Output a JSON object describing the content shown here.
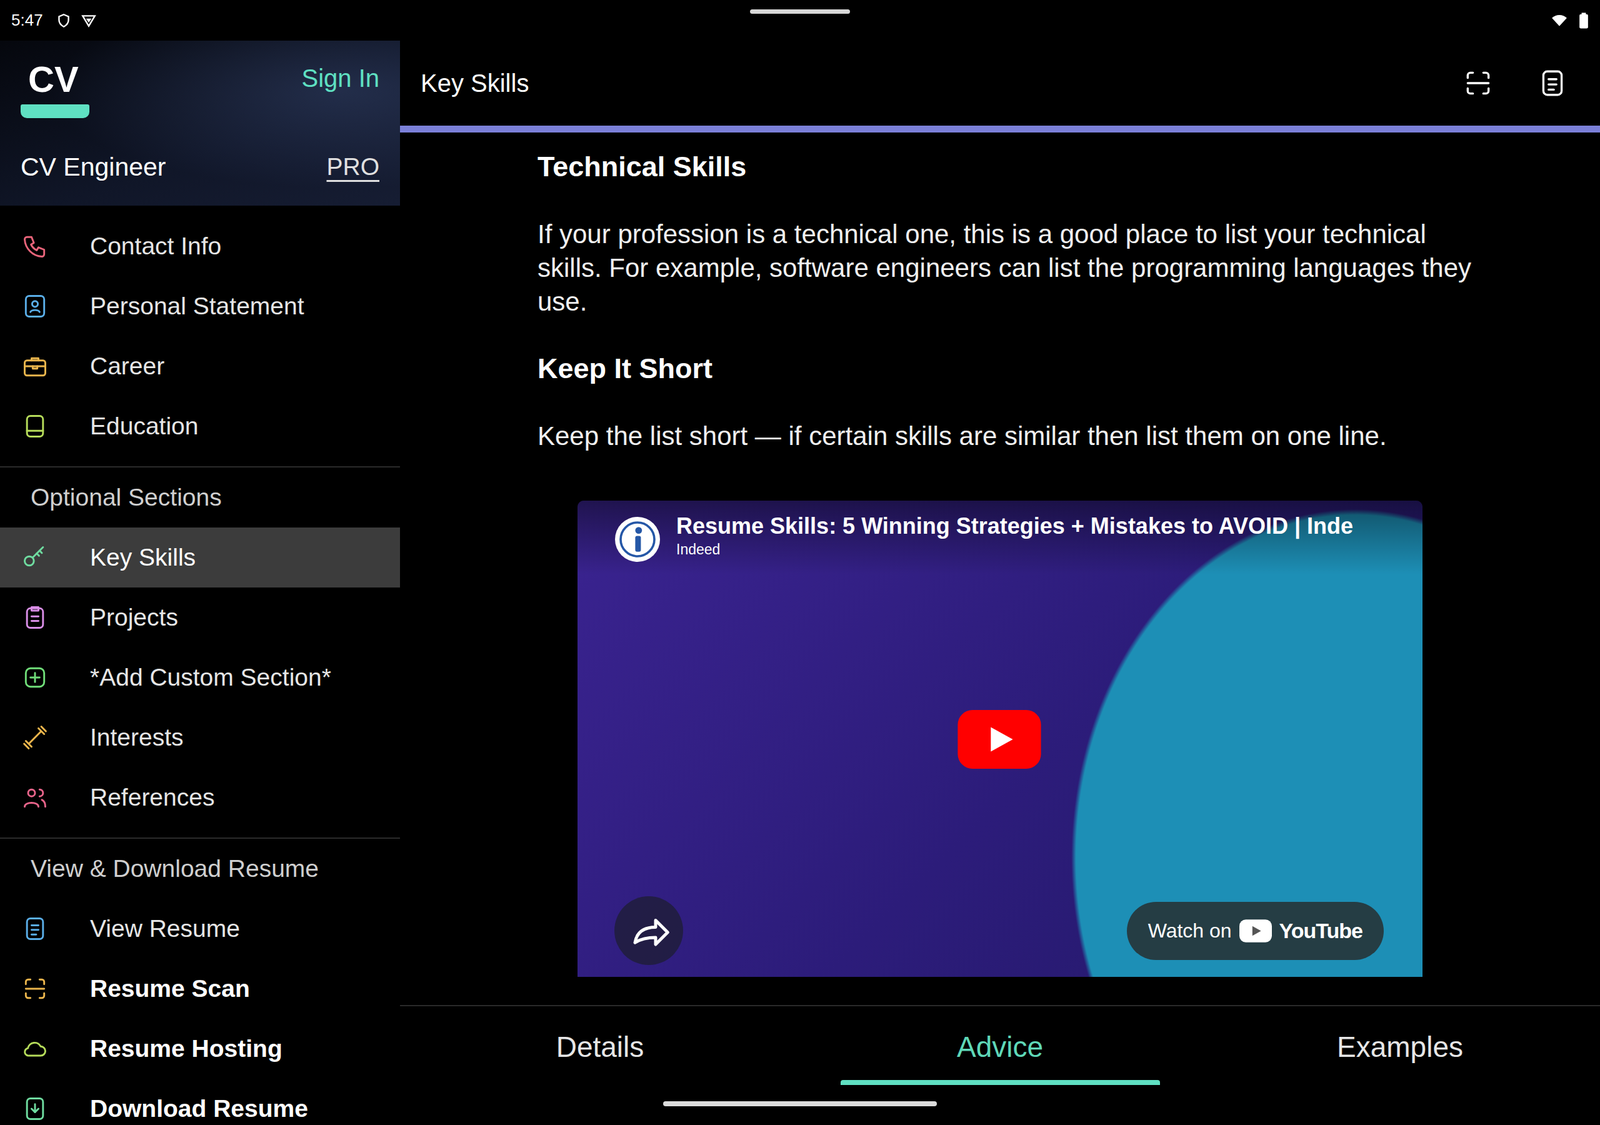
{
  "status_bar": {
    "time": "5:47"
  },
  "sidebar": {
    "logo": "CV",
    "sign_in": "Sign In",
    "app_name": "CV Engineer",
    "plan": "PRO",
    "primary_items": [
      {
        "label": "Contact Info",
        "kind": "phone",
        "color": "#e8647a",
        "selected": false,
        "emphasized": false
      },
      {
        "label": "Personal Statement",
        "kind": "person",
        "color": "#5aaee8",
        "selected": false,
        "emphasized": false
      },
      {
        "label": "Career",
        "kind": "briefcase",
        "color": "#eab54c",
        "selected": false,
        "emphasized": false
      },
      {
        "label": "Education",
        "kind": "book",
        "color": "#b6dc5a",
        "selected": false,
        "emphasized": false
      }
    ],
    "groups": [
      {
        "title": "Optional Sections",
        "items": [
          {
            "label": "Key Skills",
            "kind": "key",
            "color": "#6fdca0",
            "selected": true,
            "emphasized": false
          },
          {
            "label": "Projects",
            "kind": "clipboard",
            "color": "#d98ee6",
            "selected": false,
            "emphasized": false
          },
          {
            "label": "*Add Custom Section*",
            "kind": "plus",
            "color": "#6fdc78",
            "selected": false,
            "emphasized": false
          },
          {
            "label": "Interests",
            "kind": "dumbbell",
            "color": "#eab54c",
            "selected": false,
            "emphasized": false
          },
          {
            "label": "References",
            "kind": "people",
            "color": "#e8648a",
            "selected": false,
            "emphasized": false
          }
        ]
      },
      {
        "title": "View & Download Resume",
        "items": [
          {
            "label": "View Resume",
            "kind": "document",
            "color": "#5aaee8",
            "selected": false,
            "emphasized": false
          },
          {
            "label": "Resume Scan",
            "kind": "scan",
            "color": "#eab54c",
            "selected": false,
            "emphasized": true
          },
          {
            "label": "Resume Hosting",
            "kind": "cloud",
            "color": "#b6dc5a",
            "selected": false,
            "emphasized": true
          },
          {
            "label": "Download Resume",
            "kind": "download",
            "color": "#6fdca0",
            "selected": false,
            "emphasized": true
          }
        ]
      }
    ]
  },
  "toolbar": {
    "title": "Key Skills"
  },
  "advice": {
    "blocks": [
      {
        "heading": "Technical Skills",
        "body": "If your profession is a technical one, this is a good place to list your technical skills. For example, software engineers can list the programming languages they use."
      },
      {
        "heading": "Keep It Short",
        "body": "Keep the list short — if certain skills are similar then list them on one line."
      }
    ]
  },
  "video": {
    "title": "Resume Skills: 5 Winning Strategies + Mistakes to AVOID | Inde",
    "channel": "Indeed",
    "watch_label": "Watch on",
    "platform": "YouTube"
  },
  "tabs": [
    {
      "label": "Details",
      "selected": false
    },
    {
      "label": "Advice",
      "selected": true
    },
    {
      "label": "Examples",
      "selected": false
    }
  ]
}
